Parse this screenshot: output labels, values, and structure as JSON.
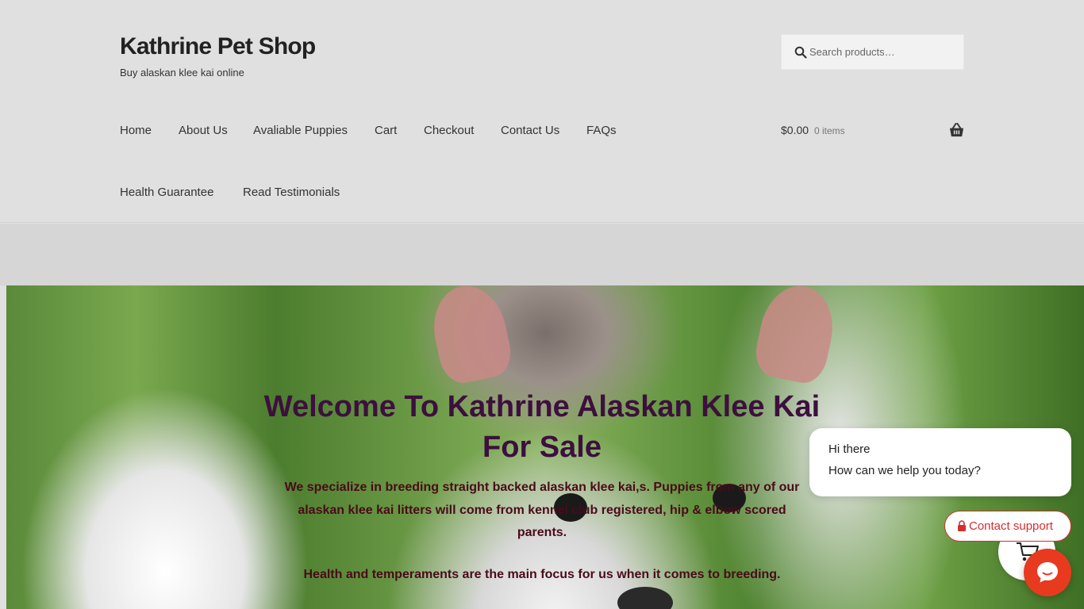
{
  "header": {
    "site_title": "Kathrine Pet Shop",
    "tagline": "Buy alaskan klee kai online",
    "search_placeholder": "Search products…"
  },
  "nav": {
    "items": [
      "Home",
      "About Us",
      "Avaliable Puppies",
      "Cart",
      "Checkout",
      "Contact Us",
      "FAQs",
      "Health Guarantee",
      "Read Testimonials"
    ]
  },
  "cart": {
    "amount": "$0.00",
    "count": "0 items"
  },
  "hero": {
    "title": "Welcome To Kathrine Alaskan Klee Kai For Sale",
    "text1": "We specialize in breeding straight backed alaskan klee kai,s. Puppies from any of our alaskan klee kai litters will come from kennel club registered, hip & elbow scored parents.",
    "text2": "Health and temperaments are the main focus for us when it comes to breeding."
  },
  "chat": {
    "greeting_line1": "Hi there",
    "greeting_line2": "How can we help you today?",
    "contact_label": "Contact support"
  },
  "colors": {
    "header_bg": "#e0e0e0",
    "hero_title": "#3d0f3f",
    "hero_text": "#4a0a1a",
    "accent_red": "#e83a1f"
  },
  "icons": {
    "search": "search-icon",
    "basket": "basket-icon",
    "chat": "chat-icon",
    "cart": "cart-icon"
  }
}
